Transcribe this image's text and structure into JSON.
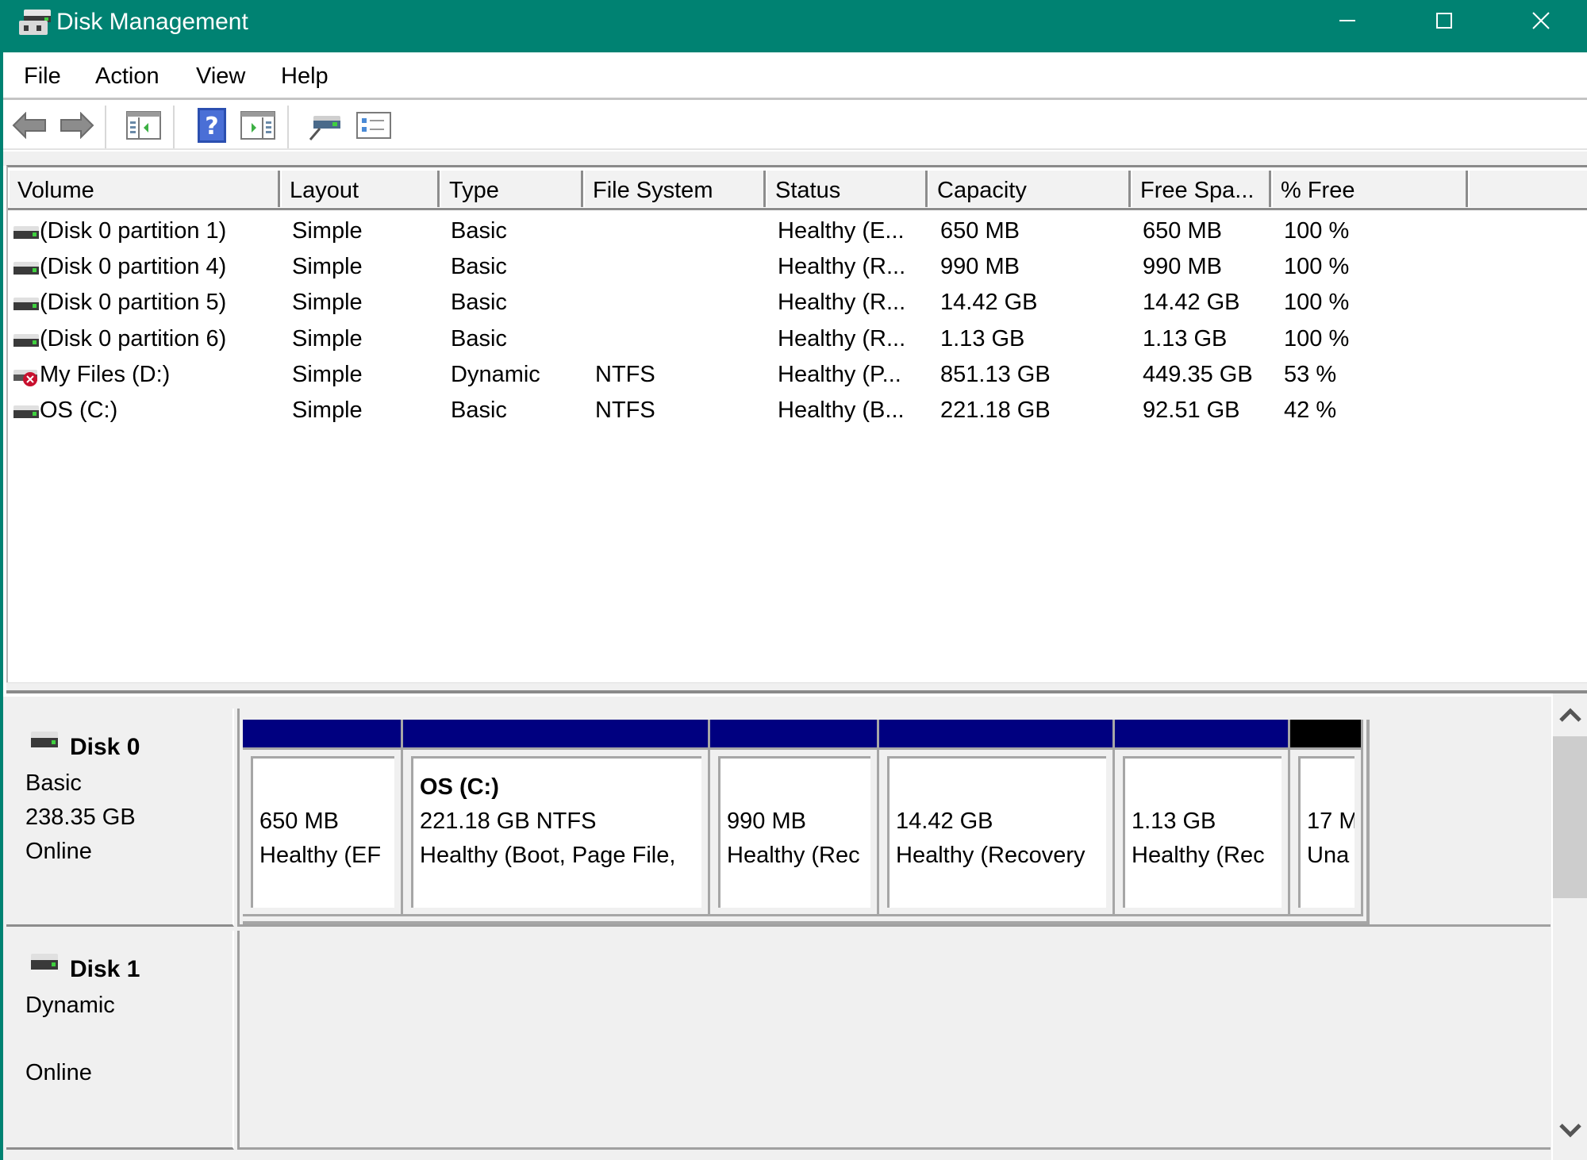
{
  "window": {
    "title": "Disk Management",
    "controls": {
      "minimize": "minimize",
      "maximize": "maximize",
      "close": "close"
    }
  },
  "menu": [
    "File",
    "Action",
    "View",
    "Help"
  ],
  "toolbar": {
    "buttons": [
      {
        "name": "back",
        "icon": "back-arrow-icon"
      },
      {
        "name": "forward",
        "icon": "forward-arrow-icon"
      },
      {
        "name": "show-hide-console-tree",
        "icon": "console-tree-icon"
      },
      {
        "name": "help",
        "icon": "help-icon",
        "glyph": "?"
      },
      {
        "name": "show-hide-action-pane",
        "icon": "action-pane-icon"
      },
      {
        "name": "connect-virtual-disk",
        "icon": "disk-connect-icon"
      },
      {
        "name": "properties",
        "icon": "properties-list-icon"
      }
    ]
  },
  "volume_list": {
    "columns": [
      "Volume",
      "Layout",
      "Type",
      "File System",
      "Status",
      "Capacity",
      "Free Spa...",
      "% Free"
    ],
    "rows": [
      {
        "icon": "disk-icon",
        "volume": "(Disk 0 partition 1)",
        "layout": "Simple",
        "type": "Basic",
        "fs": "",
        "status": "Healthy (E...",
        "capacity": "650 MB",
        "free": "650 MB",
        "pct": "100 %"
      },
      {
        "icon": "disk-icon",
        "volume": "(Disk 0 partition 4)",
        "layout": "Simple",
        "type": "Basic",
        "fs": "",
        "status": "Healthy (R...",
        "capacity": "990 MB",
        "free": "990 MB",
        "pct": "100 %"
      },
      {
        "icon": "disk-icon",
        "volume": "(Disk 0 partition 5)",
        "layout": "Simple",
        "type": "Basic",
        "fs": "",
        "status": "Healthy (R...",
        "capacity": "14.42 GB",
        "free": "14.42 GB",
        "pct": "100 %"
      },
      {
        "icon": "disk-icon",
        "volume": "(Disk 0 partition 6)",
        "layout": "Simple",
        "type": "Basic",
        "fs": "",
        "status": "Healthy (R...",
        "capacity": "1.13 GB",
        "free": "1.13 GB",
        "pct": "100 %"
      },
      {
        "icon": "disk-error-icon",
        "volume": "My Files (D:)",
        "layout": "Simple",
        "type": "Dynamic",
        "fs": "NTFS",
        "status": "Healthy (P...",
        "capacity": "851.13 GB",
        "free": "449.35 GB",
        "pct": "53 %"
      },
      {
        "icon": "disk-icon",
        "volume": "OS (C:)",
        "layout": "Simple",
        "type": "Basic",
        "fs": "NTFS",
        "status": "Healthy (B...",
        "capacity": "221.18 GB",
        "free": "92.51 GB",
        "pct": "42 %"
      }
    ]
  },
  "disks": [
    {
      "name": "Disk 0",
      "type": "Basic",
      "size": "238.35 GB",
      "state": "Online",
      "partitions": [
        {
          "title": "",
          "line1": "650 MB",
          "line2": "Healthy (EF",
          "bar_color": "#000080"
        },
        {
          "title": "OS  (C:)",
          "line1": "221.18 GB NTFS",
          "line2": "Healthy (Boot, Page File,",
          "bar_color": "#000080"
        },
        {
          "title": "",
          "line1": "990 MB",
          "line2": "Healthy (Rec",
          "bar_color": "#000080"
        },
        {
          "title": "",
          "line1": "14.42 GB",
          "line2": "Healthy (Recovery",
          "bar_color": "#000080"
        },
        {
          "title": "",
          "line1": "1.13 GB",
          "line2": "Healthy (Rec",
          "bar_color": "#000080"
        },
        {
          "title": "",
          "line1": "17 M",
          "line2": "Una",
          "bar_color": "#000000"
        }
      ]
    },
    {
      "name": "Disk 1",
      "type": "Dynamic",
      "size": "",
      "state": "Online",
      "partitions": []
    }
  ],
  "colors": {
    "titlebar": "#008272",
    "primary_partition": "#000080",
    "unallocated": "#000000"
  }
}
